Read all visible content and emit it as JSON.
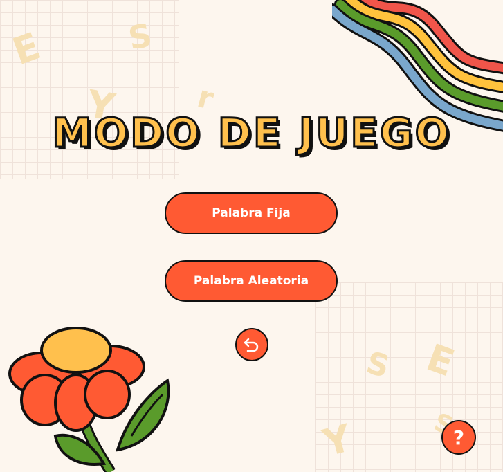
{
  "title": "MODO DE JUEGO",
  "buttons": {
    "fixed_word": "Palabra Fija",
    "random_word": "Palabra Aleatoria"
  },
  "back_button": {
    "icon": "undo-arrow-icon"
  },
  "help_button": {
    "label": "?"
  },
  "background_letters": [
    "E",
    "S",
    "Y",
    "r",
    "S",
    "E",
    "Y",
    "S"
  ],
  "colors": {
    "background": "#fdf6ee",
    "accent": "#ff5a33",
    "title_fill": "#ffc04d",
    "outline": "#111111",
    "wave_red": "#f0554a",
    "wave_yellow": "#ffc23d",
    "wave_green": "#5a9b2b",
    "wave_blue": "#7aa7cc"
  }
}
